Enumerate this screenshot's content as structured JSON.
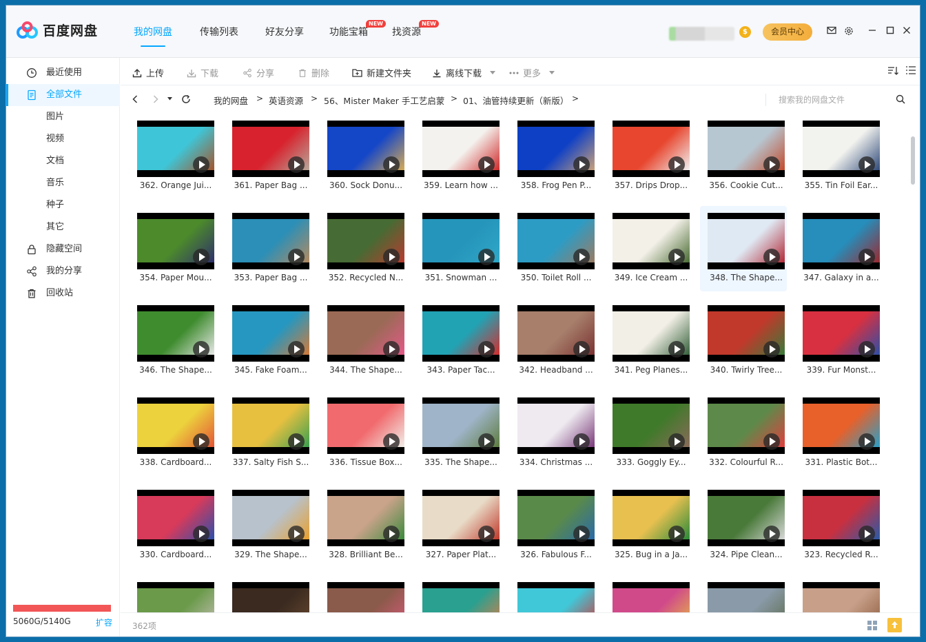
{
  "app": {
    "name": "百度网盘"
  },
  "nav": {
    "tabs": [
      {
        "label": "我的网盘",
        "active": true
      },
      {
        "label": "传输列表"
      },
      {
        "label": "好友分享"
      },
      {
        "label": "功能宝箱",
        "badge": "NEW"
      },
      {
        "label": "找资源",
        "badge": "NEW"
      }
    ],
    "coin": "$",
    "vip_label": "会员中心"
  },
  "sidebar": {
    "items": [
      {
        "label": "最近使用",
        "icon": "clock-icon"
      },
      {
        "label": "全部文件",
        "icon": "file-icon",
        "active": true
      },
      {
        "label": "图片",
        "sub": true
      },
      {
        "label": "视频",
        "sub": true
      },
      {
        "label": "文档",
        "sub": true
      },
      {
        "label": "音乐",
        "sub": true
      },
      {
        "label": "种子",
        "sub": true
      },
      {
        "label": "其它",
        "sub": true
      },
      {
        "label": "隐藏空间",
        "icon": "lock-icon"
      },
      {
        "label": "我的分享",
        "icon": "share-icon"
      },
      {
        "label": "回收站",
        "icon": "trash-icon"
      }
    ],
    "quota": "5060G/5140G",
    "quota_used_fraction": 0.984,
    "expand_label": "扩容"
  },
  "toolbar": {
    "upload": "上传",
    "download": "下载",
    "share": "分享",
    "delete": "删除",
    "new_folder": "新建文件夹",
    "offline_download": "离线下载",
    "more": "更多"
  },
  "breadcrumb": {
    "items": [
      "我的网盘",
      "英语资源",
      "56、Mister Maker 手工艺启蒙",
      "01、油管持续更新（新版）"
    ],
    "separator": ">"
  },
  "search": {
    "placeholder": "搜索我的网盘文件"
  },
  "files": [
    {
      "name": "362. Orange Jui...",
      "c1": "#3ec6d8",
      "c2": "#a3552c"
    },
    {
      "name": "361. Paper Bag ...",
      "c1": "#d8222d",
      "c2": "#b7a79a"
    },
    {
      "name": "360. Sock Donu...",
      "c1": "#1446c8",
      "c2": "#d6ab55"
    },
    {
      "name": "359. Learn how ...",
      "c1": "#f4f2ee",
      "c2": "#cf2a2a"
    },
    {
      "name": "358. Frog Pen P...",
      "c1": "#0e40c6",
      "c2": "#c8a07a"
    },
    {
      "name": "357. Drips Drop...",
      "c1": "#e8462e",
      "c2": "#f0f0f0"
    },
    {
      "name": "356. Cookie Cut...",
      "c1": "#b7c7d2",
      "c2": "#c24b2c"
    },
    {
      "name": "355. Tin Foil Ear...",
      "c1": "#f2f2ee",
      "c2": "#2f4a7a"
    },
    {
      "name": "354. Paper Mou...",
      "c1": "#4c8a2b",
      "c2": "#2f2f6b"
    },
    {
      "name": "353. Paper Bag ...",
      "c1": "#2b8fb7",
      "c2": "#b38a60"
    },
    {
      "name": "352. Recycled N...",
      "c1": "#476b34",
      "c2": "#b73b30"
    },
    {
      "name": "351. Snowman ...",
      "c1": "#2695bb",
      "c2": "#2fa8c8"
    },
    {
      "name": "350. Toilet Roll ...",
      "c1": "#2d9cc4",
      "c2": "#9a7b63"
    },
    {
      "name": "349. Ice Cream ...",
      "c1": "#f3f0e8",
      "c2": "#4a6c33"
    },
    {
      "name": "348. The Shape...",
      "c1": "#dfe9f3",
      "c2": "#b22a38",
      "selected": true
    },
    {
      "name": "347. Galaxy in a...",
      "c1": "#278dba",
      "c2": "#9b2a30"
    },
    {
      "name": "346. The Shape...",
      "c1": "#3f8c2f",
      "c2": "#e8e8e8"
    },
    {
      "name": "345. Fake Foam...",
      "c1": "#2697c0",
      "c2": "#d37a3a"
    },
    {
      "name": "344. The Shape...",
      "c1": "#9a6a56",
      "c2": "#e35a88"
    },
    {
      "name": "343. Paper Tac...",
      "c1": "#21a3b4",
      "c2": "#d32e2e"
    },
    {
      "name": "342. Headband ...",
      "c1": "#a77f6b",
      "c2": "#7a3232"
    },
    {
      "name": "341. Peg Planes...",
      "c1": "#f2efe6",
      "c2": "#34603a"
    },
    {
      "name": "340. Twirly Tree...",
      "c1": "#c0392b",
      "c2": "#3a7a3a"
    },
    {
      "name": "339. Fur Monst...",
      "c1": "#d83040",
      "c2": "#2d4fa8"
    },
    {
      "name": "338. Cardboard...",
      "c1": "#ecd23d",
      "c2": "#e35535"
    },
    {
      "name": "337. Salty Fish S...",
      "c1": "#e8c040",
      "c2": "#3aa050"
    },
    {
      "name": "336. Tissue Box...",
      "c1": "#f16b6e",
      "c2": "#f1efea"
    },
    {
      "name": "335. The Shape...",
      "c1": "#9fb4c8",
      "c2": "#5d7c3f"
    },
    {
      "name": "334. Christmas ...",
      "c1": "#eeeaf0",
      "c2": "#7a3a7a"
    },
    {
      "name": "333. Goggly Ey...",
      "c1": "#3f7a2a",
      "c2": "#8a6a5a"
    },
    {
      "name": "332. Colourful R...",
      "c1": "#5d8a4a",
      "c2": "#e04040"
    },
    {
      "name": "331. Plastic Bot...",
      "c1": "#e8602a",
      "c2": "#2aa0c8"
    },
    {
      "name": "330. Cardboard...",
      "c1": "#d83a5a",
      "c2": "#2d4faa"
    },
    {
      "name": "329. The Shape...",
      "c1": "#b7c2cc",
      "c2": "#e8a030"
    },
    {
      "name": "328. Brilliant Be...",
      "c1": "#c9a38a",
      "c2": "#3c8a3c"
    },
    {
      "name": "327. Paper Plat...",
      "c1": "#e8dcc8",
      "c2": "#c0392b"
    },
    {
      "name": "326. Fabulous F...",
      "c1": "#5a8a4a",
      "c2": "#2a6aa8"
    },
    {
      "name": "325. Bug in a Ja...",
      "c1": "#e8c050",
      "c2": "#2a8a3a"
    },
    {
      "name": "324. Pipe Clean...",
      "c1": "#4a7a3a",
      "c2": "#d8d8d8"
    },
    {
      "name": "323. Recycled R...",
      "c1": "#c83040",
      "c2": "#2a5aa8"
    },
    {
      "name": "",
      "c1": "#6a9a4a",
      "c2": "#c8c0b8"
    },
    {
      "name": "",
      "c1": "#3a2a20",
      "c2": "#6a4a30"
    },
    {
      "name": "",
      "c1": "#8a5a4a",
      "c2": "#d85a7a"
    },
    {
      "name": "",
      "c1": "#2aa090",
      "c2": "#e87a40"
    },
    {
      "name": "",
      "c1": "#40c8d8",
      "c2": "#d83030"
    },
    {
      "name": "",
      "c1": "#d04a8a",
      "c2": "#e8c040"
    },
    {
      "name": "",
      "c1": "#8a9aa8",
      "c2": "#5a6a4a"
    },
    {
      "name": "",
      "c1": "#c8a08a",
      "c2": "#8a5a3a"
    }
  ],
  "status": {
    "count": "362项"
  }
}
